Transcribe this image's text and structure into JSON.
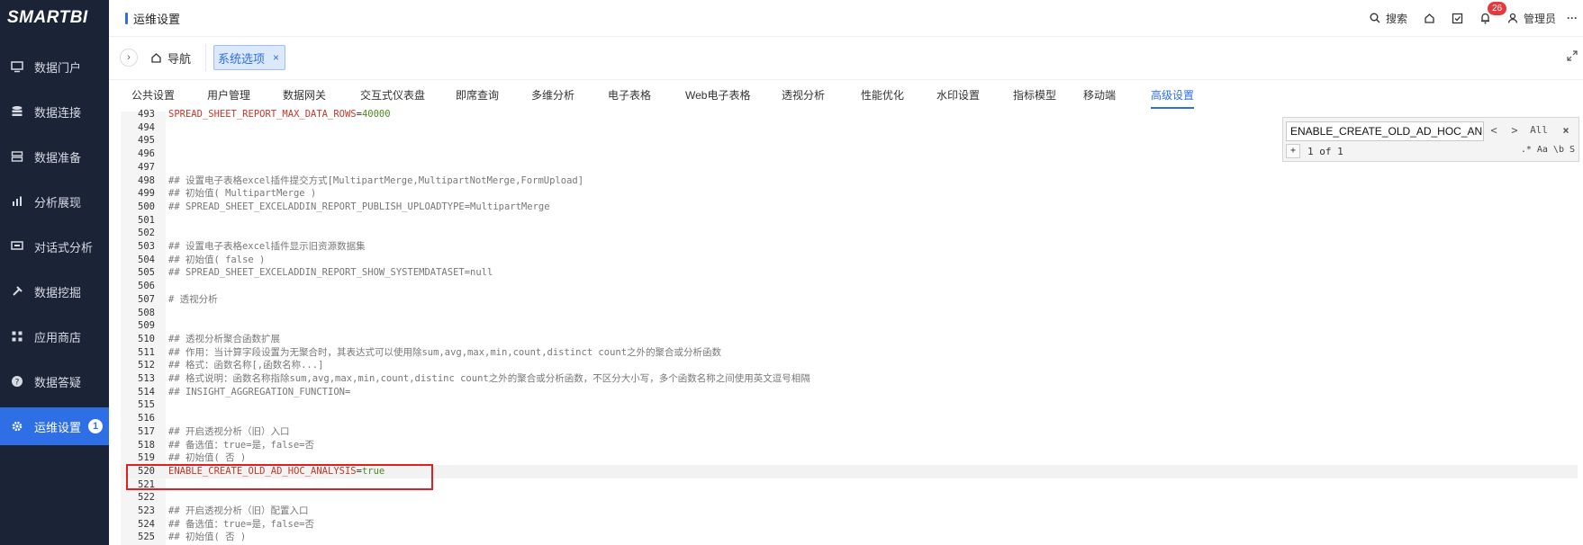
{
  "brand": {
    "logo": "SMARTBI"
  },
  "sidebar": {
    "items": [
      {
        "label": "数据门户",
        "icon": "monitor-icon"
      },
      {
        "label": "数据连接",
        "icon": "database-icon"
      },
      {
        "label": "数据准备",
        "icon": "server-icon"
      },
      {
        "label": "分析展现",
        "icon": "bar-chart-icon"
      },
      {
        "label": "对话式分析",
        "icon": "chat-icon"
      },
      {
        "label": "数据挖掘",
        "icon": "pickaxe-icon"
      },
      {
        "label": "应用商店",
        "icon": "apps-icon"
      },
      {
        "label": "数据答疑",
        "icon": "help-icon"
      },
      {
        "label": "运维设置",
        "icon": "gear-icon",
        "badge": "1",
        "active": true
      }
    ]
  },
  "header": {
    "title": "运维设置",
    "search_label": "搜索",
    "notification_count": "26",
    "user_label": "管理员",
    "more": "···"
  },
  "tabs": {
    "home_label": "导航",
    "open_tab_label": "系统选项",
    "close": "×"
  },
  "subtabs": [
    "公共设置",
    "用户管理",
    "数据网关",
    "交互式仪表盘",
    "即席查询",
    "多维分析",
    "电子表格",
    "Web电子表格",
    "透视分析",
    "性能优化",
    "水印设置",
    "指标模型",
    "移动端",
    "高级设置"
  ],
  "editor": {
    "lines": [
      {
        "n": "493",
        "t": "SPREAD_SHEET_REPORT_MAX_DATA_ROWS",
        "v": "40000",
        "kv": true
      },
      {
        "n": "494",
        "t": ""
      },
      {
        "n": "495",
        "t": ""
      },
      {
        "n": "496",
        "t": ""
      },
      {
        "n": "497",
        "t": ""
      },
      {
        "n": "498",
        "t": "## 设置电子表格excel插件提交方式[MultipartMerge,MultipartNotMerge,FormUpload]"
      },
      {
        "n": "499",
        "t": "## 初始值( MultipartMerge )"
      },
      {
        "n": "500",
        "t": "## SPREAD_SHEET_EXCELADDIN_REPORT_PUBLISH_UPLOADTYPE=MultipartMerge"
      },
      {
        "n": "501",
        "t": ""
      },
      {
        "n": "502",
        "t": ""
      },
      {
        "n": "503",
        "t": "## 设置电子表格excel插件显示旧资源数据集"
      },
      {
        "n": "504",
        "t": "## 初始值( false )"
      },
      {
        "n": "505",
        "t": "## SPREAD_SHEET_EXCELADDIN_REPORT_SHOW_SYSTEMDATASET=null"
      },
      {
        "n": "506",
        "t": ""
      },
      {
        "n": "507",
        "t": "# 透视分析"
      },
      {
        "n": "508",
        "t": ""
      },
      {
        "n": "509",
        "t": ""
      },
      {
        "n": "510",
        "t": "## 透视分析聚合函数扩展"
      },
      {
        "n": "511",
        "t": "## 作用：当计算字段设置为无聚合时，其表达式可以使用除sum,avg,max,min,count,distinct count之外的聚合或分析函数"
      },
      {
        "n": "512",
        "t": "## 格式：函数名称[,函数名称...]"
      },
      {
        "n": "513",
        "t": "## 格式说明：函数名称指除sum,avg,max,min,count,distinc count之外的聚合或分析函数，不区分大小写，多个函数名称之间使用英文逗号相隔"
      },
      {
        "n": "514",
        "t": "## INSIGHT_AGGREGATION_FUNCTION="
      },
      {
        "n": "515",
        "t": ""
      },
      {
        "n": "516",
        "t": ""
      },
      {
        "n": "517",
        "t": "## 开启透视分析（旧）入口"
      },
      {
        "n": "518",
        "t": "## 备选值：true=是，false=否"
      },
      {
        "n": "519",
        "t": "## 初始值( 否 )"
      },
      {
        "n": "520",
        "t": "ENABLE_CREATE_OLD_AD_HOC_ANALYSIS",
        "v": "true",
        "kv": true,
        "highlight": true
      },
      {
        "n": "521",
        "t": ""
      },
      {
        "n": "522",
        "t": ""
      },
      {
        "n": "523",
        "t": "## 开启透视分析（旧）配置入口"
      },
      {
        "n": "524",
        "t": "## 备选值：true=是，false=否"
      },
      {
        "n": "525",
        "t": "## 初始值( 否 )"
      }
    ]
  },
  "find": {
    "query": "ENABLE_CREATE_OLD_AD_HOC_AN",
    "prev": "<",
    "next": ">",
    "all": "All",
    "close": "×",
    "expand": "+",
    "count": "1 of 1",
    "opt_regex": ".*",
    "opt_case": "Aa",
    "opt_word": "\\b",
    "opt_s": "S"
  }
}
